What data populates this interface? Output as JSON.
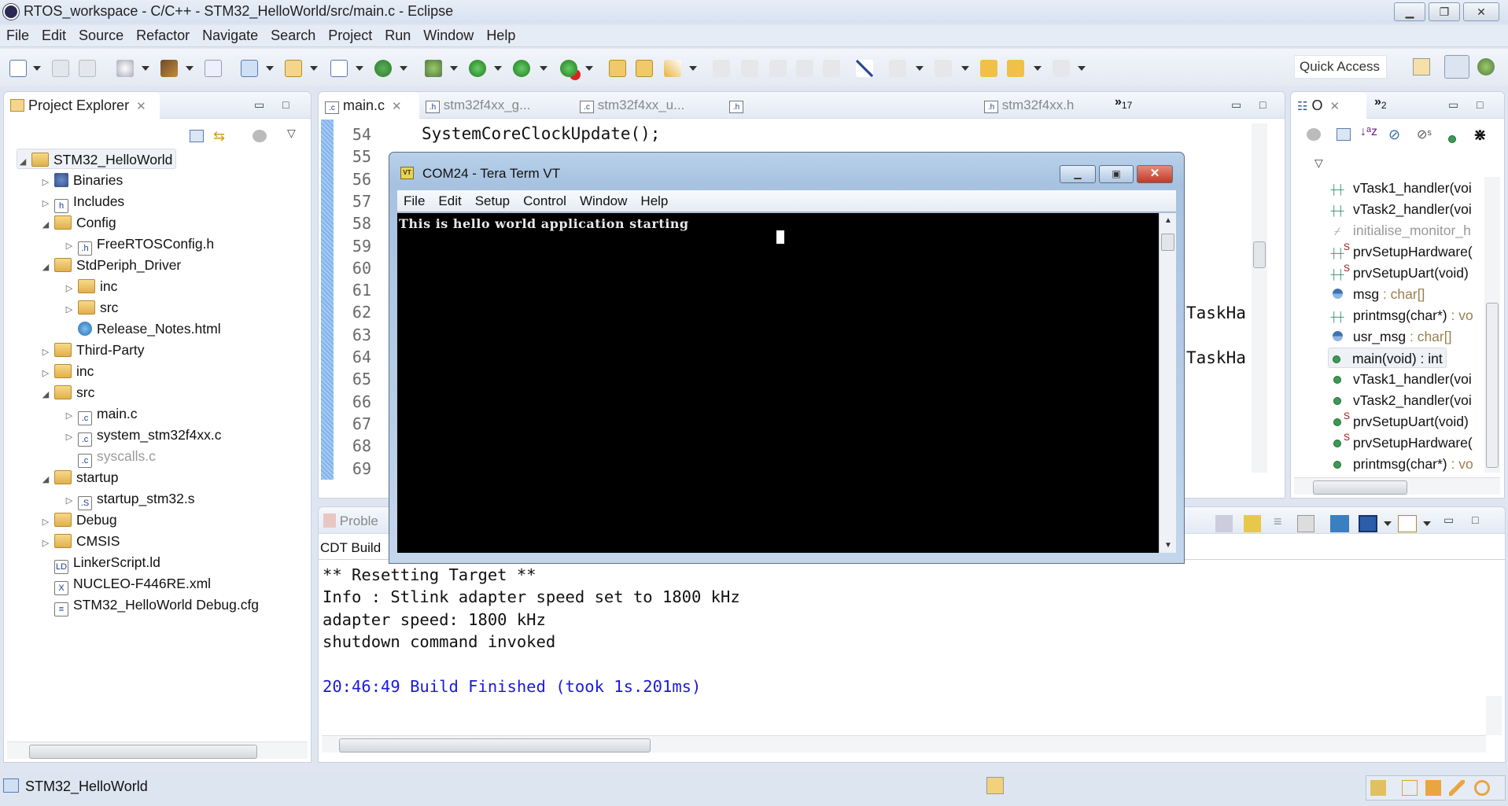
{
  "window": {
    "title": "RTOS_workspace - C/C++ - STM32_HelloWorld/src/main.c - Eclipse"
  },
  "menu": [
    "File",
    "Edit",
    "Source",
    "Refactor",
    "Navigate",
    "Search",
    "Project",
    "Run",
    "Window",
    "Help"
  ],
  "toolbar": {
    "quick_access": "Quick Access"
  },
  "project_explorer": {
    "tab_label": "Project Explorer",
    "tree": [
      {
        "label": "STM32_HelloWorld",
        "depth": 0,
        "twisty": "open",
        "icon": "project-folder-icon",
        "selected": true
      },
      {
        "label": "Binaries",
        "depth": 1,
        "twisty": "closed",
        "icon": "binaries-icon"
      },
      {
        "label": "Includes",
        "depth": 1,
        "twisty": "closed",
        "icon": "includes-icon"
      },
      {
        "label": "Config",
        "depth": 1,
        "twisty": "open",
        "icon": "source-folder-icon"
      },
      {
        "label": "FreeRTOSConfig.h",
        "depth": 2,
        "twisty": "closed",
        "icon": "header-file-icon"
      },
      {
        "label": "StdPeriph_Driver",
        "depth": 1,
        "twisty": "open",
        "icon": "source-folder-icon"
      },
      {
        "label": "inc",
        "depth": 2,
        "twisty": "closed",
        "icon": "folder-icon"
      },
      {
        "label": "src",
        "depth": 2,
        "twisty": "closed",
        "icon": "folder-icon"
      },
      {
        "label": "Release_Notes.html",
        "depth": 2,
        "twisty": "none",
        "icon": "html-file-icon"
      },
      {
        "label": "Third-Party",
        "depth": 1,
        "twisty": "closed",
        "icon": "source-folder-icon"
      },
      {
        "label": "inc",
        "depth": 1,
        "twisty": "closed",
        "icon": "source-folder-icon"
      },
      {
        "label": "src",
        "depth": 1,
        "twisty": "open",
        "icon": "source-folder-icon"
      },
      {
        "label": "main.c",
        "depth": 2,
        "twisty": "closed",
        "icon": "c-file-icon"
      },
      {
        "label": "system_stm32f4xx.c",
        "depth": 2,
        "twisty": "closed",
        "icon": "c-file-icon"
      },
      {
        "label": "syscalls.c",
        "depth": 2,
        "twisty": "none",
        "icon": "excluded-c-file-icon",
        "disabled": true
      },
      {
        "label": "startup",
        "depth": 1,
        "twisty": "open",
        "icon": "source-folder-icon"
      },
      {
        "label": "startup_stm32.s",
        "depth": 2,
        "twisty": "closed",
        "icon": "asm-file-icon"
      },
      {
        "label": "Debug",
        "depth": 1,
        "twisty": "closed",
        "icon": "folder-icon"
      },
      {
        "label": "CMSIS",
        "depth": 1,
        "twisty": "closed",
        "icon": "folder-icon"
      },
      {
        "label": "LinkerScript.ld",
        "depth": 1,
        "twisty": "none",
        "icon": "linker-file-icon"
      },
      {
        "label": "NUCLEO-F446RE.xml",
        "depth": 1,
        "twisty": "none",
        "icon": "xml-file-icon"
      },
      {
        "label": "STM32_HelloWorld Debug.cfg",
        "depth": 1,
        "twisty": "none",
        "icon": "text-file-icon"
      }
    ]
  },
  "editor": {
    "tabs": [
      {
        "label": "main.c",
        "active": true,
        "icon": "c-file-icon"
      },
      {
        "label": "stm32f4xx_g...",
        "icon": "header-file-icon"
      },
      {
        "label": "stm32f4xx_u...",
        "icon": "c-file-icon"
      },
      {
        "label": "",
        "icon": "header-file-icon"
      },
      {
        "label": "stm32f4xx.h",
        "icon": "header-file-icon"
      }
    ],
    "overflow_count": "17",
    "line_numbers": [
      "54",
      "55",
      "56",
      "57",
      "58",
      "59",
      "60",
      "61",
      "62",
      "63",
      "64",
      "65",
      "66",
      "67",
      "68",
      "69"
    ],
    "code_line_54": "SystemCoreClockUpdate();",
    "visible_fragments": [
      "TaskHa",
      "TaskHa"
    ]
  },
  "teraterm": {
    "title": "COM24 - Tera Term VT",
    "menu": [
      "File",
      "Edit",
      "Setup",
      "Control",
      "Window",
      "Help"
    ],
    "output": "This is hello world application starting"
  },
  "outline": {
    "tab_label": "O",
    "overflow_count": "2",
    "items": [
      {
        "label": "vTask1_handler(voi",
        "kind": "declaration"
      },
      {
        "label": "vTask2_handler(voi",
        "kind": "declaration"
      },
      {
        "label": "initialise_monitor_h",
        "kind": "declaration-disabled"
      },
      {
        "label": "prvSetupHardware(",
        "kind": "declaration",
        "static": true
      },
      {
        "label": "prvSetupUart(void)",
        "kind": "declaration",
        "static": true
      },
      {
        "label": "msg",
        "type": " : char[]",
        "kind": "variable"
      },
      {
        "label": "printmsg(char*)",
        "type": " : vo",
        "kind": "declaration"
      },
      {
        "label": "usr_msg",
        "type": " : char[]",
        "kind": "variable"
      },
      {
        "label": "main(void) : int",
        "kind": "function",
        "selected": true
      },
      {
        "label": "vTask1_handler(voi",
        "kind": "function"
      },
      {
        "label": "vTask2_handler(voi",
        "kind": "function"
      },
      {
        "label": "prvSetupUart(void)",
        "kind": "function",
        "static": true
      },
      {
        "label": "prvSetupHardware(",
        "kind": "function",
        "static": true
      },
      {
        "label": "printmsg(char*)",
        "type": " : vo",
        "kind": "function"
      }
    ]
  },
  "console": {
    "problems_tab": "Proble",
    "console_title": "CDT Build",
    "lines": [
      "** Resetting Target **",
      "Info : Stlink adapter speed set to 1800 kHz",
      "adapter speed: 1800 kHz",
      "shutdown command invoked",
      "",
      "20:46:49 Build Finished (took 1s.201ms)"
    ],
    "finished_color": "#1a1adb"
  },
  "status_bar": {
    "selected_item": "STM32_HelloWorld"
  }
}
